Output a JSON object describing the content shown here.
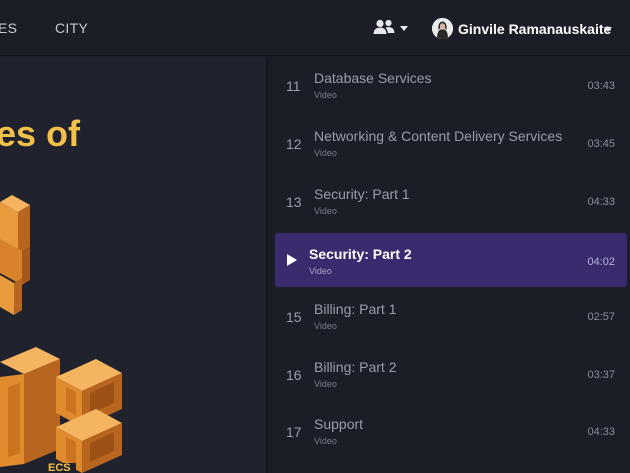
{
  "nav": {
    "items": [
      {
        "label": "ES"
      },
      {
        "label": "CITY"
      }
    ]
  },
  "header": {
    "user_name": "Ginvile Ramanauskaite",
    "icons": [
      "people-icon",
      "caret-down-icon",
      "avatar",
      "caret-down-icon"
    ]
  },
  "player": {
    "slide_title": "es of",
    "slide_caption": "ECS"
  },
  "lectures": [
    {
      "num": "11",
      "title": "Database Services",
      "type": "Video",
      "duration": "03:43"
    },
    {
      "num": "12",
      "title": "Networking & Content Delivery Services",
      "type": "Video",
      "duration": "03:45"
    },
    {
      "num": "13",
      "title": "Security: Part 1",
      "type": "Video",
      "duration": "04:33"
    },
    {
      "num": "",
      "title": "Security: Part 2",
      "type": "Video",
      "duration": "04:02",
      "active": true
    },
    {
      "num": "15",
      "title": "Billing: Part 1",
      "type": "Video",
      "duration": "02:57"
    },
    {
      "num": "16",
      "title": "Billing: Part 2",
      "type": "Video",
      "duration": "03:37"
    },
    {
      "num": "17",
      "title": "Support",
      "type": "Video",
      "duration": "04:33"
    }
  ],
  "colors": {
    "accent_active": "#3a2a6e",
    "slide_title": "#f2c14a",
    "aws_orange": "#e08a2e"
  }
}
